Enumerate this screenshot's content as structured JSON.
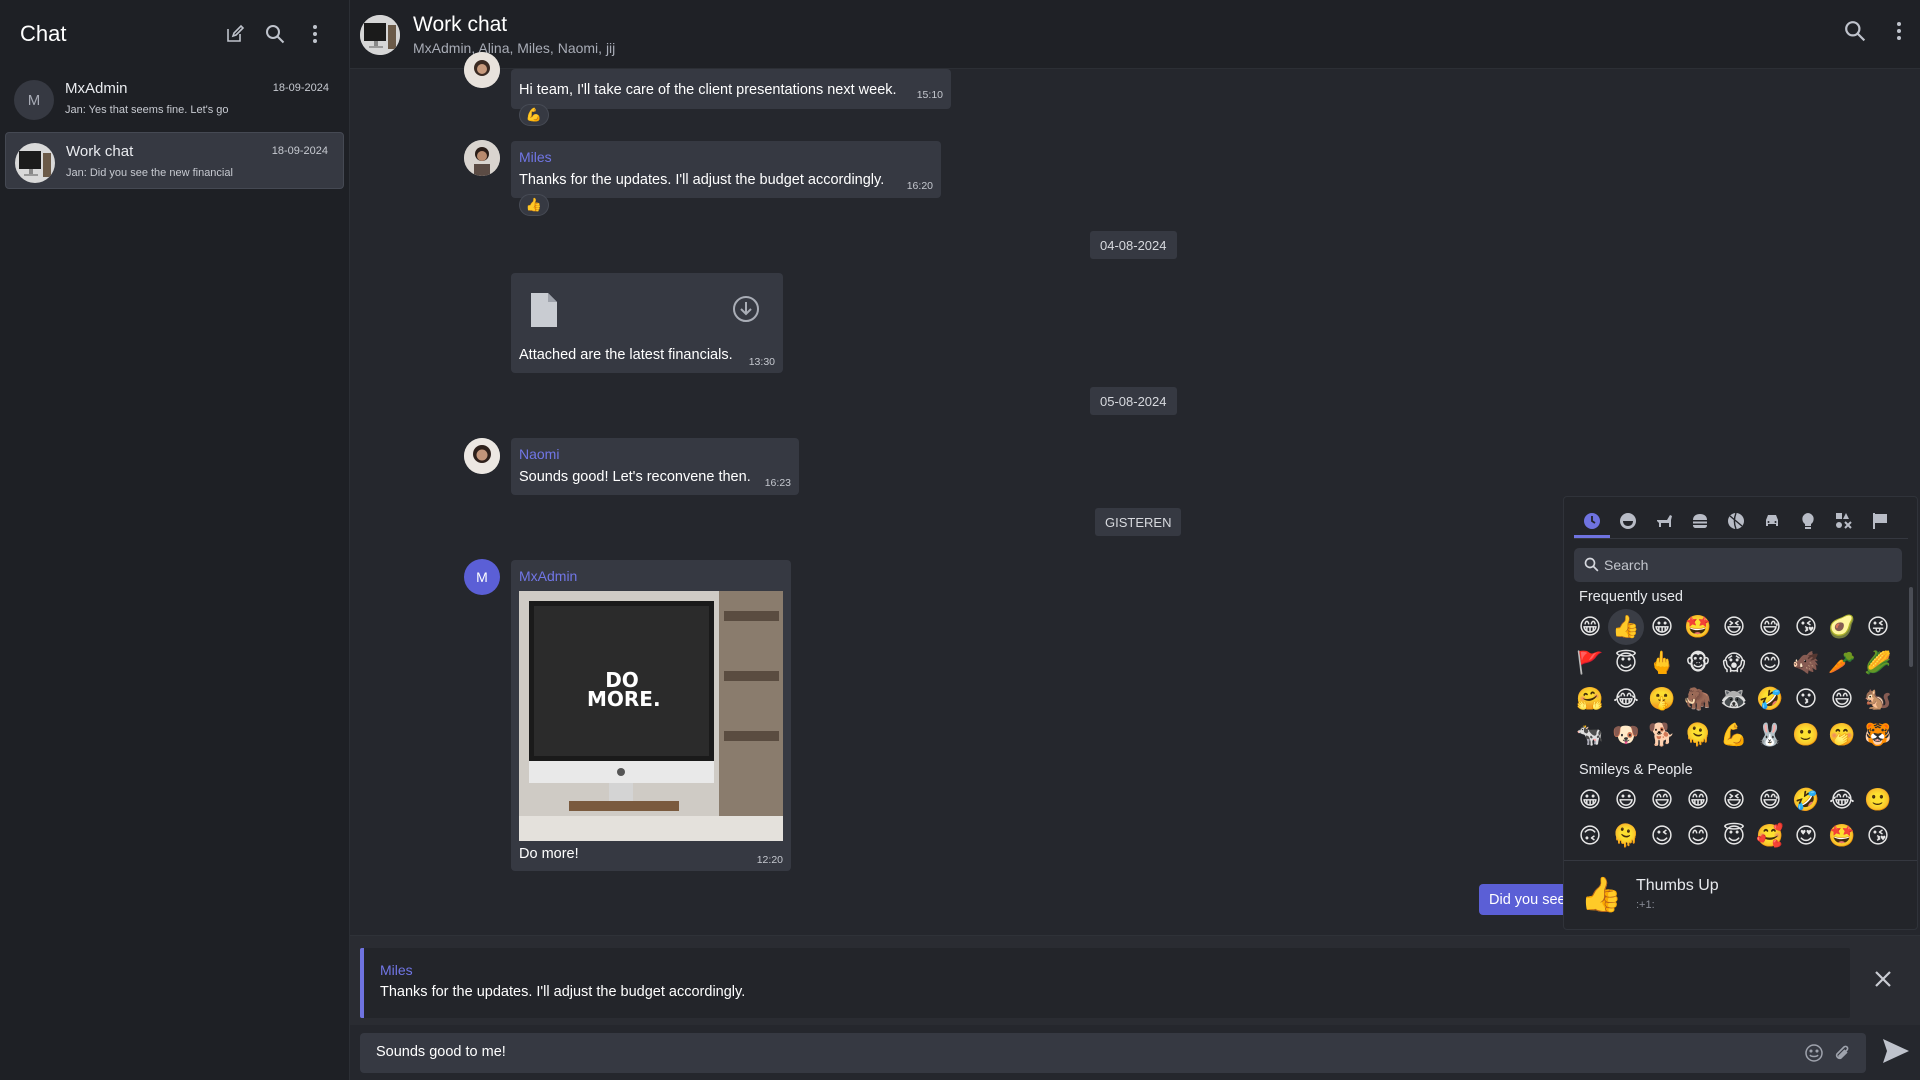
{
  "sidebar": {
    "title": "Chat",
    "chats": [
      {
        "avatar_letter": "M",
        "name": "MxAdmin",
        "date": "18-09-2024",
        "preview": "Jan:  Yes that seems fine. Let's go"
      },
      {
        "avatar_letter": "",
        "name": "Work chat",
        "date": "18-09-2024",
        "preview": "Jan:  Did you see the new financial"
      }
    ]
  },
  "header": {
    "title": "Work chat",
    "members": "MxAdmin, Alina, Miles, Naomi, jij"
  },
  "messages": [
    {
      "sender": "Naomi",
      "text": "Hi team, I'll take care of the client presentations next week.",
      "time": "15:10",
      "reaction": "💪"
    },
    {
      "sender": "Miles",
      "text": "Thanks for the updates. I'll adjust the budget accordingly.",
      "time": "16:20",
      "reaction": "👍"
    },
    {
      "date": "04-08-2024"
    },
    {
      "sender": "",
      "text": "Attached are the latest financials.",
      "time": "13:30",
      "attachment": "file"
    },
    {
      "date": "05-08-2024"
    },
    {
      "sender": "Naomi",
      "text": "Sounds good! Let's reconvene then.",
      "time": "16:23"
    },
    {
      "date": "GISTEREN"
    },
    {
      "sender": "MxAdmin",
      "avatar_letter": "M",
      "text": "Do more!",
      "time": "12:20",
      "image_text": "DO MORE."
    }
  ],
  "own_message_peek": "Did you see",
  "reply": {
    "name": "Miles",
    "text": "Thanks for the updates. I'll adjust the budget accordingly."
  },
  "input": {
    "value": "Sounds good to me!"
  },
  "emoji_picker": {
    "search_placeholder": "Search",
    "frequently_used_title": "Frequently used",
    "frequently_used": [
      "😁",
      "👍",
      "😀",
      "🤩",
      "😆",
      "😅",
      "😘",
      "🥑",
      "😜",
      "🚩",
      "😇",
      "🖕",
      "🐵",
      "😱",
      "😊",
      "🐗",
      "🥕",
      "🌽",
      "🤗",
      "😂",
      "🤫",
      "🦣",
      "🦝",
      "🤣",
      "😗",
      "😄",
      "🐿️",
      "🐄",
      "🐶",
      "🐕",
      "🫠",
      "💪",
      "🐰",
      "🙂",
      "🤭",
      "🐯"
    ],
    "smileys_title": "Smileys & People",
    "smileys": [
      "😀",
      "😃",
      "😄",
      "😁",
      "😆",
      "😅",
      "🤣",
      "😂",
      "🙂",
      "🙃",
      "🫠",
      "😉",
      "😊",
      "😇",
      "🥰",
      "😍",
      "🤩",
      "😘"
    ],
    "preview": {
      "emoji": "👍",
      "name": "Thumbs Up",
      "code": ":+1:"
    }
  },
  "colors": {
    "accent": "#6f73e0",
    "own_bubble": "#5b5fd6"
  }
}
